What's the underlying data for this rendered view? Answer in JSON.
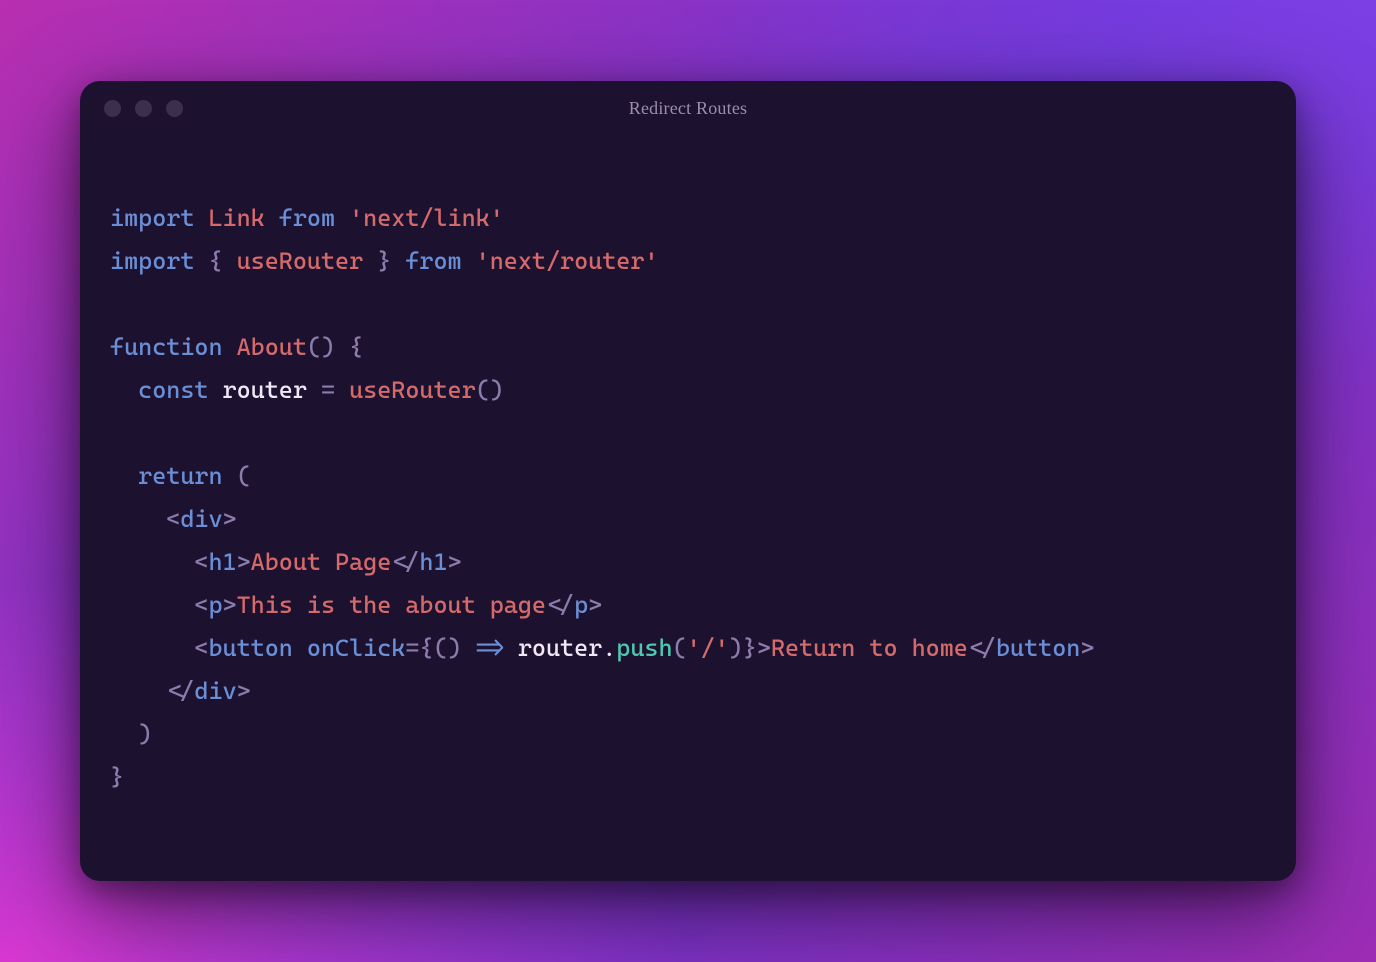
{
  "titlebar": {
    "title": "Redirect Routes"
  },
  "code": {
    "line1": {
      "import": "import",
      "link": "Link",
      "from": "from",
      "str": "'next/link'"
    },
    "line2": {
      "import": "import",
      "lb": "{",
      "ur": "useRouter",
      "rb": "}",
      "from": "from",
      "str": "'next/router'"
    },
    "line3": "",
    "line4": {
      "fn": "function",
      "name": "About",
      "parens": "()",
      "lb": "{"
    },
    "line5": {
      "const": "const",
      "router": "router",
      "eq": "=",
      "ur": "useRouter",
      "parens": "()"
    },
    "line6": "",
    "line7": {
      "ret": "return",
      "lp": "("
    },
    "line8": {
      "pad": "    ",
      "lt": "<",
      "tag": "div",
      "gt": ">"
    },
    "line9": {
      "pad": "      ",
      "lt": "<",
      "tag": "h1",
      "gt": ">",
      "text": "About Page",
      "lt2": "</",
      "tag2": "h1",
      "gt2": ">"
    },
    "line10": {
      "pad": "      ",
      "lt": "<",
      "tag": "p",
      "gt": ">",
      "text": "This is the about page",
      "lt2": "</",
      "tag2": "p",
      "gt2": ">"
    },
    "line11": {
      "pad": "      ",
      "lt": "<",
      "tag": "button",
      "sp": " ",
      "attr": "onClick",
      "eq": "=",
      "lb": "{",
      "lp": "()",
      "arrow": " => ",
      "obj": "router",
      "dot": ".",
      "method": "push",
      "call_lp": "(",
      "arg": "'/'",
      "call_rp": ")",
      "rb": "}",
      "gt": ">",
      "text": "Return to home",
      "lt2": "</",
      "tag2": "button",
      "gt2": ">"
    },
    "line12": {
      "pad": "    ",
      "lt": "</",
      "tag": "div",
      "gt": ">"
    },
    "line13": {
      "pad": "  ",
      "rp": ")"
    },
    "line14": {
      "rb": "}"
    }
  }
}
